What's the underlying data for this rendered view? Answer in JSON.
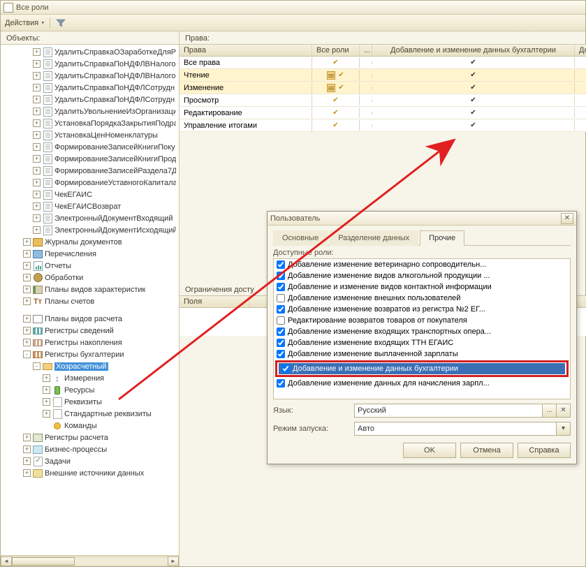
{
  "window_title": "Все роли",
  "toolbar": {
    "actions_label": "Действия"
  },
  "left": {
    "label": "Объекты:",
    "tree": [
      {
        "l": 3,
        "e": "+",
        "ico": "doc",
        "t": "УдалитьСправкаОЗаработкеДляРа"
      },
      {
        "l": 3,
        "e": "+",
        "ico": "doc",
        "t": "УдалитьСправкаПоНДФЛВНалого"
      },
      {
        "l": 3,
        "e": "+",
        "ico": "doc",
        "t": "УдалитьСправкаПоНДФЛВНалого"
      },
      {
        "l": 3,
        "e": "+",
        "ico": "doc",
        "t": "УдалитьСправкаПоНДФЛСотрудн"
      },
      {
        "l": 3,
        "e": "+",
        "ico": "doc",
        "t": "УдалитьСправкаПоНДФЛСотрудн"
      },
      {
        "l": 3,
        "e": "+",
        "ico": "doc",
        "t": "УдалитьУвольнениеИзОрганизаци"
      },
      {
        "l": 3,
        "e": "+",
        "ico": "doc",
        "t": "УстановкаПорядкаЗакрытияПодра"
      },
      {
        "l": 3,
        "e": "+",
        "ico": "doc",
        "t": "УстановкаЦенНоменклатуры"
      },
      {
        "l": 3,
        "e": "+",
        "ico": "doc",
        "t": "ФормированиеЗаписейКнигиПоку"
      },
      {
        "l": 3,
        "e": "+",
        "ico": "doc",
        "t": "ФормированиеЗаписейКнигиПрод"
      },
      {
        "l": 3,
        "e": "+",
        "ico": "doc",
        "t": "ФормированиеЗаписейРаздела7Д"
      },
      {
        "l": 3,
        "e": "+",
        "ico": "doc",
        "t": "ФормированиеУставногоКапитала"
      },
      {
        "l": 3,
        "e": "+",
        "ico": "doc",
        "t": "ЧекЕГАИС"
      },
      {
        "l": 3,
        "e": "+",
        "ico": "doc",
        "t": "ЧекЕГАИСВозврат"
      },
      {
        "l": 3,
        "e": "+",
        "ico": "doc",
        "t": "ЭлектронныйДокументВходящий"
      },
      {
        "l": 3,
        "e": "+",
        "ico": "doc",
        "t": "ЭлектронныйДокументИсходящий"
      },
      {
        "l": 2,
        "e": "+",
        "ico": "book",
        "t": "Журналы документов"
      },
      {
        "l": 2,
        "e": "+",
        "ico": "enum",
        "t": "Перечисления"
      },
      {
        "l": 2,
        "e": "+",
        "ico": "report",
        "t": "Отчеты"
      },
      {
        "l": 2,
        "e": "+",
        "ico": "gear",
        "t": "Обработки"
      },
      {
        "l": 2,
        "e": "+",
        "ico": "plan",
        "t": "Планы видов характеристик"
      },
      {
        "l": 2,
        "e": "+",
        "ico": "acct",
        "t": "Планы счетов"
      },
      {
        "l": 2,
        "e": "",
        "ico": "",
        "t": ""
      },
      {
        "l": 2,
        "e": "+",
        "ico": "calc",
        "t": "Планы видов расчета"
      },
      {
        "l": 2,
        "e": "+",
        "ico": "reg",
        "t": "Регистры сведений"
      },
      {
        "l": 2,
        "e": "+",
        "ico": "reg2",
        "t": "Регистры накопления"
      },
      {
        "l": 2,
        "e": "-",
        "ico": "reg3",
        "t": "Регистры бухгалтерии"
      },
      {
        "l": 3,
        "e": "-",
        "ico": "reg3b",
        "t": "Хозрасчетный",
        "sel": true
      },
      {
        "l": 4,
        "e": "+",
        "ico": "dim",
        "t": "Измерения"
      },
      {
        "l": 4,
        "e": "+",
        "ico": "res",
        "t": "Ресурсы"
      },
      {
        "l": 4,
        "e": "+",
        "ico": "req",
        "t": "Реквизиты"
      },
      {
        "l": 4,
        "e": "+",
        "ico": "req",
        "t": "Стандартные реквизиты"
      },
      {
        "l": 4,
        "e": "",
        "ico": "dot",
        "t": "Команды"
      },
      {
        "l": 2,
        "e": "+",
        "ico": "calc2",
        "t": "Регистры расчета"
      },
      {
        "l": 2,
        "e": "+",
        "ico": "bp",
        "t": "Бизнес-процессы"
      },
      {
        "l": 2,
        "e": "+",
        "ico": "task",
        "t": "Задачи"
      },
      {
        "l": 2,
        "e": "+",
        "ico": "ext",
        "t": "Внешние источники данных"
      }
    ]
  },
  "right": {
    "label": "Права:",
    "cols": [
      "Права",
      "Все роли",
      "...",
      "Добавление и изменение данных бухгалтерии",
      "Добавл"
    ],
    "rows": [
      {
        "t": "Все права",
        "hl": false,
        "sq": false,
        "c1": true,
        "c2": true
      },
      {
        "t": "Чтение",
        "hl": true,
        "sq": true,
        "c1": true,
        "c2": true
      },
      {
        "t": "Изменение",
        "hl": true,
        "sq": true,
        "c1": true,
        "c2": true
      },
      {
        "t": "Просмотр",
        "hl": false,
        "sq": false,
        "c1": true,
        "c2": true
      },
      {
        "t": "Редактирование",
        "hl": false,
        "sq": false,
        "c1": true,
        "c2": true
      },
      {
        "t": "Управление итогами",
        "hl": false,
        "sq": false,
        "c1": true,
        "c2": true
      }
    ],
    "access_label": "Ограничения досту",
    "access_col": "Поля"
  },
  "dialog": {
    "title": "Пользователь",
    "tabs": [
      "Основные",
      "Разделение данных",
      "Прочие"
    ],
    "active_tab": 2,
    "roles_label": "Доступные роли:",
    "roles": [
      {
        "c": true,
        "t": "Добавление изменение ветеринарно сопроводительн..."
      },
      {
        "c": true,
        "t": "Добавление изменение видов алкогольной продукции ..."
      },
      {
        "c": true,
        "t": "Добавление и изменение видов контактной информации"
      },
      {
        "c": false,
        "t": "Добавление изменение внешних пользователей"
      },
      {
        "c": true,
        "t": "Добавление изменение возвратов из регистра №2 ЕГ..."
      },
      {
        "c": false,
        "t": "Редактирование возвратов товаров от покупателя"
      },
      {
        "c": true,
        "t": "Добавление изменение входящих транспортных опера..."
      },
      {
        "c": true,
        "t": "Добавление изменение входящих ТТН ЕГАИС"
      },
      {
        "c": true,
        "t": "Добавление изменение выплаченной зарплаты"
      },
      {
        "c": true,
        "t": "Добавление и изменение данных бухгалтерии",
        "hl": true
      },
      {
        "c": true,
        "t": "Добавление изменение данных для начисления зарпл..."
      }
    ],
    "lang_label": "Язык:",
    "lang_value": "Русский",
    "mode_label": "Режим запуска:",
    "mode_value": "Авто",
    "ok": "OK",
    "cancel": "Отмена",
    "help": "Справка"
  }
}
